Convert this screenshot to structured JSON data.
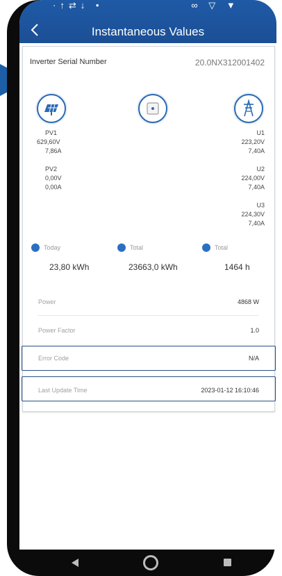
{
  "status_bar": {
    "left": "·↑⇄↓ •",
    "right": "∞ ▽ ▼ "
  },
  "header": {
    "title": "Instantaneous Values"
  },
  "inverter": {
    "serial_label": "Inverter Serial Number",
    "serial_value": "20.0NX312001402"
  },
  "pv": [
    {
      "name": "PV1",
      "voltage": "629,60V",
      "current": "7,86A"
    },
    {
      "name": "PV2",
      "voltage": "0,00V",
      "current": "0,00A"
    }
  ],
  "grid": [
    {
      "name": "U1",
      "voltage": "223,20V",
      "current": "7,40A"
    },
    {
      "name": "U2",
      "voltage": "224,00V",
      "current": "7,40A"
    },
    {
      "name": "U3",
      "voltage": "224,30V",
      "current": "7,40A"
    }
  ],
  "summary": [
    {
      "label": "Today",
      "value": "23,80 kWh",
      "icon": "today-energy-icon"
    },
    {
      "label": "Total",
      "value": "23663,0 kWh",
      "icon": "total-energy-icon"
    },
    {
      "label": "Total",
      "value": "1464 h",
      "icon": "total-hours-icon"
    }
  ],
  "details": {
    "power_label": "Power",
    "power_value": "4868 W",
    "pf_label": "Power Factor",
    "pf_value": "1.0",
    "error_label": "Error Code",
    "error_value": "N/A",
    "update_label": "Last Update Time",
    "update_value": "2023-01-12 16:10:46"
  },
  "colors": {
    "header": "#1f5aa6",
    "accent": "#2b69b3",
    "highlight_border": "#2a4f86"
  }
}
